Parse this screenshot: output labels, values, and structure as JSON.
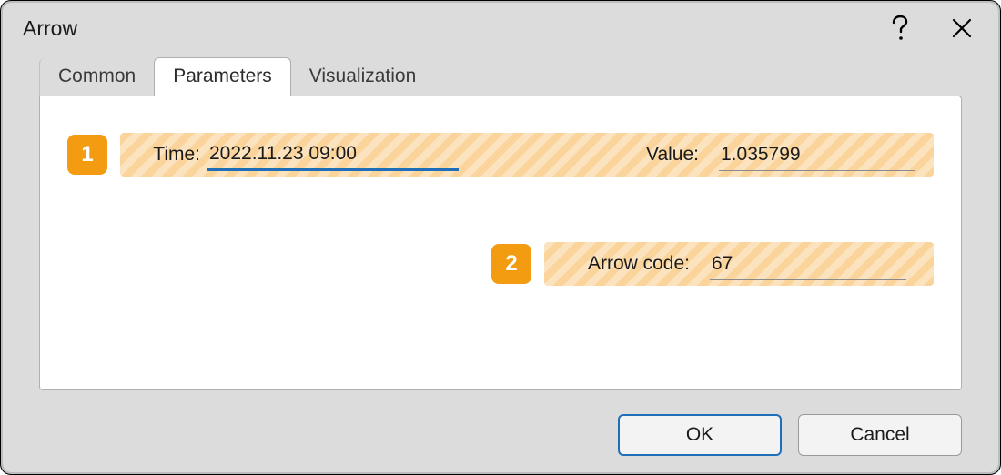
{
  "dialog": {
    "title": "Arrow"
  },
  "tabs": {
    "common": "Common",
    "parameters": "Parameters",
    "visualization": "Visualization",
    "active": "parameters"
  },
  "callouts": {
    "one": "1",
    "two": "2"
  },
  "fields": {
    "time_label": "Time:",
    "time_value": "2022.11.23 09:00",
    "value_label": "Value:",
    "value_value": "1.035799",
    "code_label": "Arrow code:",
    "code_value": "67"
  },
  "buttons": {
    "ok": "OK",
    "cancel": "Cancel"
  }
}
